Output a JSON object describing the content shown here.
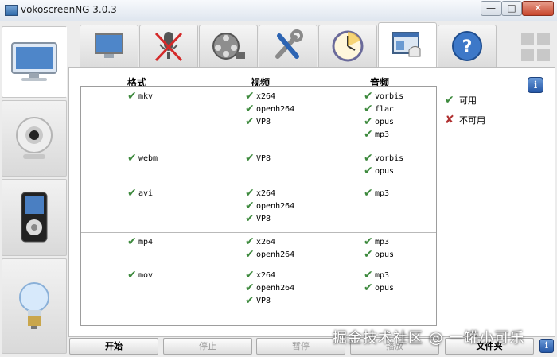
{
  "window": {
    "title": "vokoscreenNG 3.0.3",
    "controls": {
      "minimize": "—",
      "maximize": "□",
      "close": "✕"
    }
  },
  "sidebar": {
    "items": [
      {
        "icon": "monitor-icon",
        "active": true
      },
      {
        "icon": "webcam-icon",
        "active": false
      },
      {
        "icon": "media-player-icon",
        "active": false
      },
      {
        "icon": "lightbulb-icon",
        "active": false
      }
    ]
  },
  "tabs": [
    {
      "icon": "screen-tab-icon"
    },
    {
      "icon": "no-microphone-icon"
    },
    {
      "icon": "film-reel-icon"
    },
    {
      "icon": "tools-icon"
    },
    {
      "icon": "timer-clock-icon"
    },
    {
      "icon": "codecs-tab-icon",
      "active": true
    },
    {
      "icon": "help-icon"
    }
  ],
  "table": {
    "headers": {
      "format": "格式",
      "video": "视频",
      "audio": "音频"
    },
    "rows": [
      {
        "format": "mkv",
        "video": [
          "x264",
          "openh264",
          "VP8"
        ],
        "audio": [
          "vorbis",
          "flac",
          "opus",
          "mp3"
        ]
      },
      {
        "format": "webm",
        "video": [
          "VP8"
        ],
        "audio": [
          "vorbis",
          "opus"
        ]
      },
      {
        "format": "avi",
        "video": [
          "x264",
          "openh264",
          "VP8"
        ],
        "audio": [
          "mp3"
        ]
      },
      {
        "format": "mp4",
        "video": [
          "x264",
          "openh264"
        ],
        "audio": [
          "mp3",
          "opus"
        ]
      },
      {
        "format": "mov",
        "video": [
          "x264",
          "openh264",
          "VP8"
        ],
        "audio": [
          "mp3",
          "opus"
        ]
      }
    ]
  },
  "legend": {
    "available": "可用",
    "unavailable": "不可用"
  },
  "info_glyph": "i",
  "buttons": {
    "start": "开始",
    "stop": "停止",
    "pause": "暂停",
    "play": "播放",
    "folder": "文件夹"
  },
  "watermark": "掘金技术社区 @ 一罐小可乐",
  "colors": {
    "check": "#3e8a3e",
    "cross": "#b03030",
    "accent": "#2557a6"
  }
}
